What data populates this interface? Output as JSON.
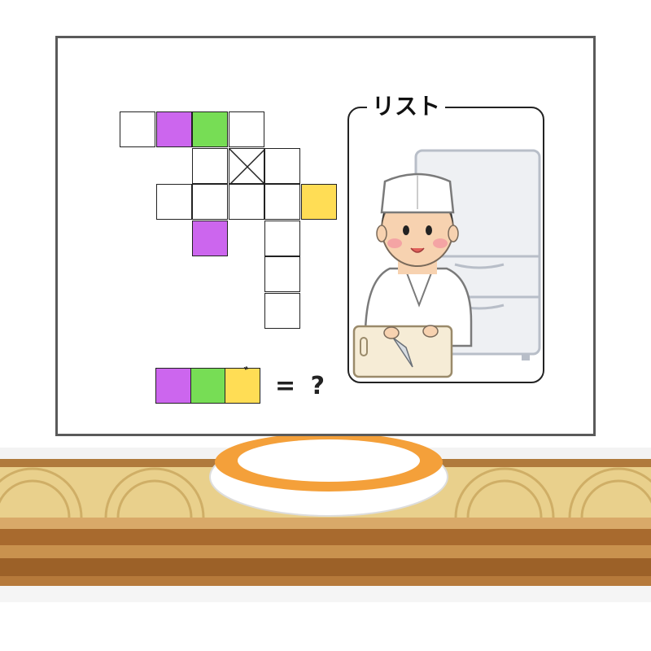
{
  "puzzle": {
    "grid_cells": [
      {
        "col": 0,
        "row": 0,
        "color": "white"
      },
      {
        "col": 1,
        "row": 0,
        "color": "purple"
      },
      {
        "col": 2,
        "row": 0,
        "color": "green"
      },
      {
        "col": 3,
        "row": 0,
        "color": "white"
      },
      {
        "col": 2,
        "row": 1,
        "color": "white"
      },
      {
        "col": 3,
        "row": 1,
        "color": "blocked"
      },
      {
        "col": 4,
        "row": 1,
        "color": "white"
      },
      {
        "col": 1,
        "row": 2,
        "color": "white"
      },
      {
        "col": 2,
        "row": 2,
        "color": "white"
      },
      {
        "col": 3,
        "row": 2,
        "color": "white"
      },
      {
        "col": 4,
        "row": 2,
        "color": "white"
      },
      {
        "col": 5,
        "row": 2,
        "color": "yellow"
      },
      {
        "col": 2,
        "row": 3,
        "color": "purple"
      },
      {
        "col": 4,
        "row": 3,
        "color": "white"
      },
      {
        "col": 4,
        "row": 4,
        "color": "white"
      },
      {
        "col": 4,
        "row": 5,
        "color": "white"
      }
    ],
    "answer_cells": [
      "purple",
      "green",
      "yellow"
    ],
    "answer_dakuten": "゛",
    "answer_suffix": "= ?",
    "colors": {
      "purple": "#cc66ee",
      "green": "#77dd55",
      "yellow": "#ffdd55"
    }
  },
  "list": {
    "title": "リスト",
    "illustration": "sushi-chef-with-knife-and-refrigerator"
  },
  "scene": {
    "counter_color": "#c8944a",
    "plate_rim_color": "#f4a03a"
  }
}
